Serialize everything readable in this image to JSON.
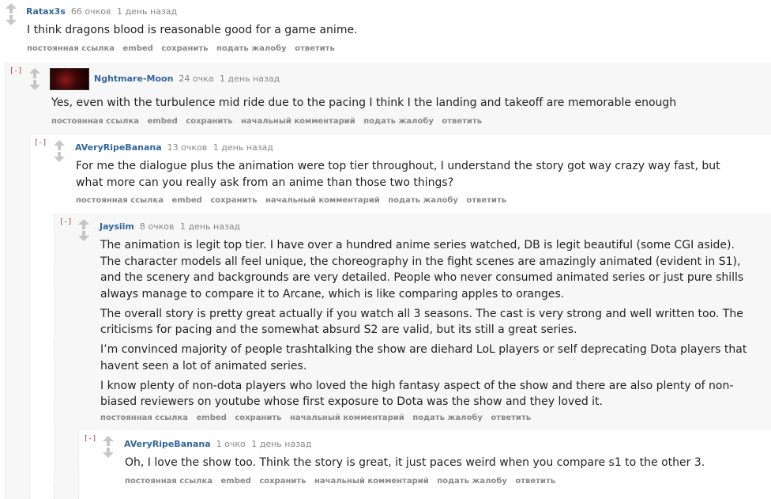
{
  "comments": [
    {
      "author": "Ratax3s",
      "score": "66 очков",
      "time": "1 день назад",
      "paragraphs": [
        "I think dragons blood is reasonable good for a game anime."
      ],
      "buttons": [
        "постоянная ссылка",
        "embed",
        "сохранить",
        "подать жалобу",
        "ответить"
      ]
    },
    {
      "collapse": "[-]",
      "author": "Nghtmare-Moon",
      "score": "24 очка",
      "time": "1 день назад",
      "paragraphs": [
        "Yes, even with the turbulence mid ride due to the pacing I think I the landing and takeoff are memorable enough"
      ],
      "buttons": [
        "постоянная ссылка",
        "embed",
        "сохранить",
        "начальный комментарий",
        "подать жалобу",
        "ответить"
      ]
    },
    {
      "collapse": "[-]",
      "author": "AVeryRipeBanana",
      "score": "13 очков",
      "time": "1 день назад",
      "paragraphs": [
        "For me the dialogue plus the animation were top tier throughout, I understand the story got way crazy way fast, but what more can you really ask from an anime than those two things?"
      ],
      "buttons": [
        "постоянная ссылка",
        "embed",
        "сохранить",
        "начальный комментарий",
        "подать жалобу",
        "ответить"
      ]
    },
    {
      "collapse": "[-]",
      "author": "Jaysiim",
      "score": "8 очков",
      "time": "1 день назад",
      "paragraphs": [
        "The animation is legit top tier. I have over a hundred anime series watched, DB is legit beautiful (some CGI aside). The character models all feel unique, the choreography in the fight scenes are amazingly animated (evident in S1), and the scenery and backgrounds are very detailed. People who never consumed animated series or just pure shills always manage to compare it to Arcane, which is like comparing apples to oranges.",
        "The overall story is pretty great actually if you watch all 3 seasons. The cast is very strong and well written too. The criticisms for pacing and the somewhat absurd S2 are valid, but its still a great series.",
        "I’m convinced majority of people trashtalking the show are diehard LoL players or self deprecating Dota players that havent seen a lot of animated series.",
        "I know plenty of non-dota players who loved the high fantasy aspect of the show and there are also plenty of non-biased reviewers on youtube whose first exposure to Dota was the show and they loved it."
      ],
      "buttons": [
        "постоянная ссылка",
        "embed",
        "сохранить",
        "начальный комментарий",
        "подать жалобу",
        "ответить"
      ]
    },
    {
      "collapse": "[-]",
      "author": "AVeryRipeBanana",
      "score": "1 очко",
      "time": "1 день назад",
      "paragraphs": [
        "Oh, I love the show too. Think the story is great, it just paces weird when you compare s1 to the other 3."
      ],
      "buttons": [
        "постоянная ссылка",
        "embed",
        "сохранить",
        "начальный комментарий",
        "подать жалобу",
        "ответить"
      ]
    }
  ]
}
